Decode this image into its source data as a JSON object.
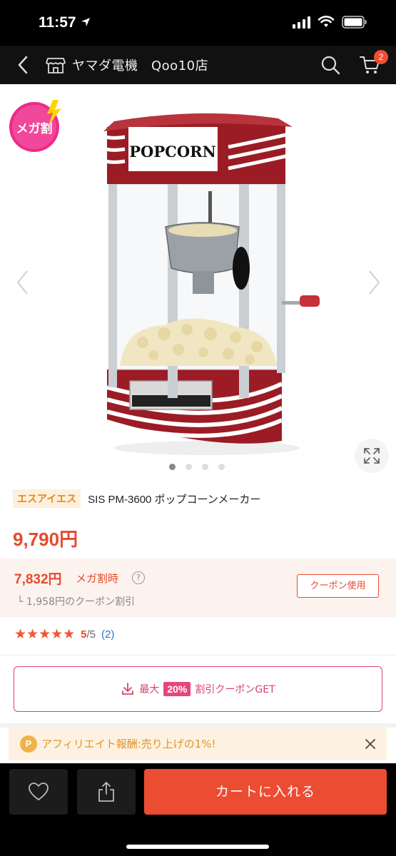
{
  "status": {
    "time": "11:57"
  },
  "header": {
    "shop_name": "ヤマダ電機　Qoo10店",
    "cart_count": "2"
  },
  "product": {
    "badge_text": "メガ割",
    "image_label": "POPCORN",
    "brand": "エスアイエス",
    "title": "SIS PM-3600 ポップコーンメーカー",
    "price": "9,790円"
  },
  "mega": {
    "price": "7,832円",
    "label": "メガ割時",
    "help": "?",
    "coupon_discount": "└ 1,958円のクーポン割引",
    "coupon_use_label": "クーポン使用"
  },
  "rating": {
    "stars": "★★★★★",
    "score": "5",
    "out_of": "/5",
    "count": "(2)"
  },
  "coupon_get": {
    "prefix": "最大",
    "percent": "20%",
    "suffix": "割引クーポンGET"
  },
  "affiliate": {
    "icon_text": "P",
    "text": "アフィリエイト報酬:売り上げの1%!"
  },
  "bottom": {
    "add_cart_label": "カートに入れる"
  },
  "carousel": {
    "total": 4,
    "active": 1
  },
  "colors": {
    "accent": "#ec4c31",
    "price": "#e64a2e",
    "coupon": "#d9456a",
    "affiliate": "#e0952b"
  }
}
